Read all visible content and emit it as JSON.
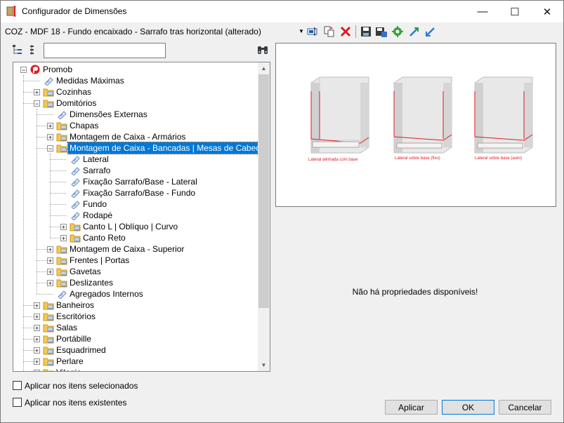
{
  "window": {
    "title": "Configurador de Dimensões",
    "minimize": "—",
    "maximize": "☐",
    "close": "✕"
  },
  "toolbar": {
    "combo_value": "COZ - MDF 18 - Fundo encaixado - Sarrafo tras horizontal (alterado)"
  },
  "search": {
    "value": ""
  },
  "tree": {
    "nodes": [
      {
        "label": "Promob"
      },
      {
        "label": "Medidas Máximas"
      },
      {
        "label": "Cozinhas"
      },
      {
        "label": "Domitórios"
      },
      {
        "label": "Dimensões Externas"
      },
      {
        "label": "Chapas"
      },
      {
        "label": "Montagem de Caixa - Armários"
      },
      {
        "label": "Montagem de Caixa - Bancadas | Mesas de Cabeceira"
      },
      {
        "label": "Lateral"
      },
      {
        "label": "Sarrafo"
      },
      {
        "label": "Fixação Sarrafo/Base - Lateral"
      },
      {
        "label": "Fixação Sarrafo/Base - Fundo"
      },
      {
        "label": "Fundo"
      },
      {
        "label": "Rodapé"
      },
      {
        "label": "Canto L | Oblíquo | Curvo"
      },
      {
        "label": "Canto Reto"
      },
      {
        "label": "Montagem de Caixa - Superior"
      },
      {
        "label": "Frentes | Portas"
      },
      {
        "label": "Gavetas"
      },
      {
        "label": "Deslizantes"
      },
      {
        "label": "Agregados Internos"
      },
      {
        "label": "Banheiros"
      },
      {
        "label": "Escritórios"
      },
      {
        "label": "Salas"
      },
      {
        "label": "Portábille"
      },
      {
        "label": "Esquadrimed"
      },
      {
        "label": "Perlare"
      },
      {
        "label": "Vilagio"
      }
    ]
  },
  "preview": {
    "captions": [
      "Lateral alinhada com base",
      "Lateral sobre base (fixo)",
      "Lateral sobre base (auto)"
    ]
  },
  "properties": {
    "empty_message": "Não há propriedades disponíveis!"
  },
  "options": {
    "apply_selected": "Aplicar nos itens selecionados",
    "apply_existing": "Aplicar nos itens existentes"
  },
  "buttons": {
    "apply": "Aplicar",
    "ok": "OK",
    "cancel": "Cancelar"
  },
  "colors": {
    "accent": "#0078d7",
    "folder": "#f5c94f",
    "doc": "#6a8fc7",
    "red": "#e0191e"
  }
}
